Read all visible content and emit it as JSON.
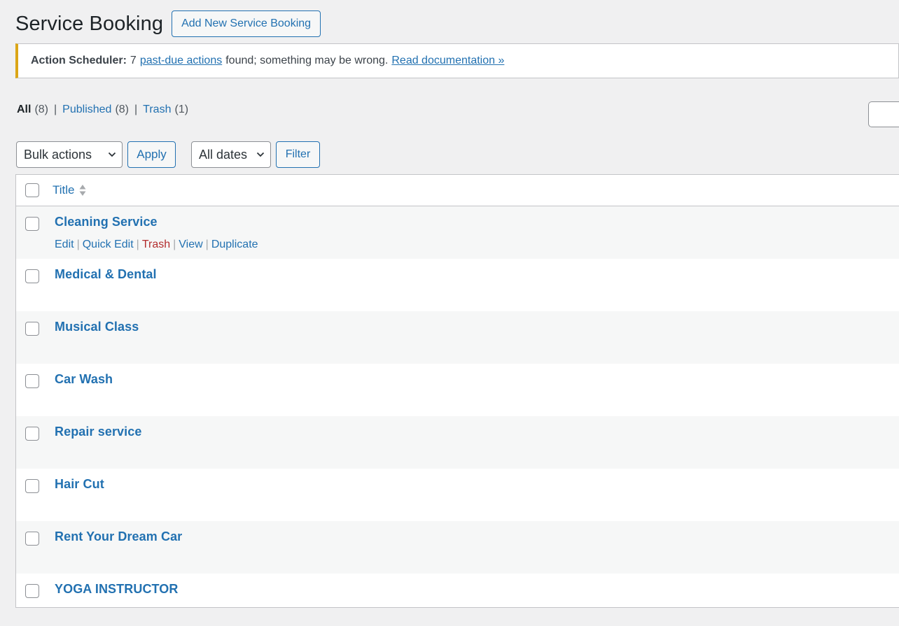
{
  "header": {
    "title": "Service Booking",
    "add_new_label": "Add New Service Booking"
  },
  "notice": {
    "prefix": "Action Scheduler:",
    "count_text": "7",
    "link_text": "past-due actions",
    "suffix": "found; something may be wrong.",
    "doc_link": "Read documentation »",
    "accent_color": "#dba617"
  },
  "views": [
    {
      "label": "All",
      "count": "(8)",
      "current": true
    },
    {
      "label": "Published",
      "count": "(8)",
      "current": false
    },
    {
      "label": "Trash",
      "count": "(1)",
      "current": false
    }
  ],
  "view_separator": "|",
  "tablenav": {
    "bulk_actions": "Bulk actions",
    "apply_label": "Apply",
    "dates": "All dates",
    "filter_label": "Filter"
  },
  "table": {
    "column_title": "Title",
    "rows": [
      {
        "title": "Cleaning Service",
        "show_actions": true
      },
      {
        "title": "Medical & Dental"
      },
      {
        "title": "Musical Class"
      },
      {
        "title": "Car Wash"
      },
      {
        "title": "Repair service"
      },
      {
        "title": "Hair Cut"
      },
      {
        "title": "Rent Your Dream Car"
      },
      {
        "title": "YOGA INSTRUCTOR"
      }
    ],
    "row_actions": {
      "edit": "Edit",
      "quick_edit": "Quick Edit",
      "trash": "Trash",
      "view": "View",
      "duplicate": "Duplicate",
      "separator": "|"
    }
  },
  "colors": {
    "link": "#2271b1",
    "danger": "#b32d2e",
    "background": "#f0f0f1"
  }
}
